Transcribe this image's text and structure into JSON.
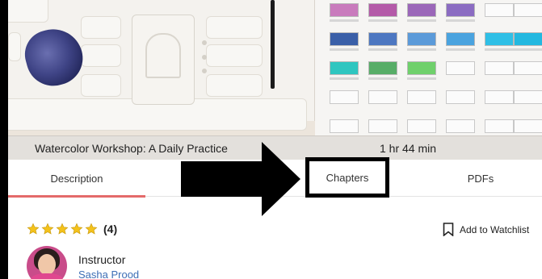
{
  "video": {
    "title": "Watercolor Workshop: A Daily Practice",
    "duration": "1 hr 44 min"
  },
  "tabs": [
    {
      "label": "Description",
      "active": true
    },
    {
      "label": "Chapters",
      "highlighted": true
    },
    {
      "label": "PDFs"
    }
  ],
  "rating": {
    "stars": 5,
    "count_label": "(4)",
    "star_color": "#f4c21b"
  },
  "watchlist": {
    "label": "Add to Watchlist",
    "icon": "bookmark-icon"
  },
  "instructor": {
    "label": "Instructor",
    "name": "Sasha Prood"
  },
  "colors": {
    "accent": "#e46a6a",
    "link": "#3d6fb6",
    "annotation": "#000000"
  },
  "swatches": [
    [
      "#c97bbd",
      "#b45aa8",
      "#9b67b9",
      "#8b6cc2",
      null,
      null
    ],
    [
      "#3a5fa8",
      "#4d77c1",
      "#5b9ad9",
      "#4aa3df",
      "#2fbfe6",
      "#23b8e0"
    ],
    [
      "#2fc6c0",
      "#57ad67",
      "#6fd06b",
      null,
      null,
      null
    ]
  ]
}
